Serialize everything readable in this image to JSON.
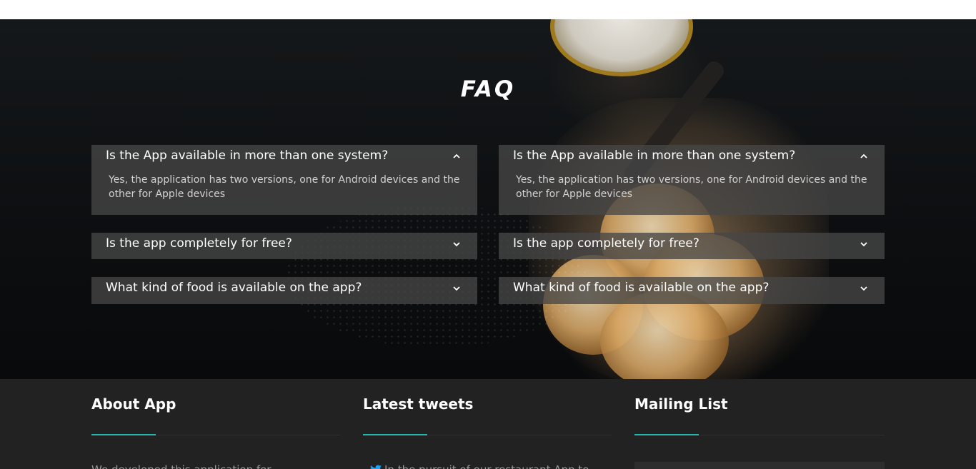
{
  "faq": {
    "title": "FAQ",
    "columns": [
      {
        "items": [
          {
            "question": "Is the App available in more than one system?",
            "answer": "Yes, the application has two versions, one for Android devices and the other for Apple devices",
            "expanded": true
          },
          {
            "question": "Is the app completely for free?",
            "expanded": false
          },
          {
            "question": "What kind of food is available on the app?",
            "expanded": false
          }
        ]
      },
      {
        "items": [
          {
            "question": "Is the App available in more than one system?",
            "answer": "Yes, the application has two versions, one for Android devices and the other for Apple devices",
            "expanded": true
          },
          {
            "question": "Is the app completely for free?",
            "expanded": false
          },
          {
            "question": "What kind of food is available on the app?",
            "expanded": false
          }
        ]
      }
    ]
  },
  "footer": {
    "about": {
      "title": "About App",
      "text": "We developed this application for"
    },
    "tweets": {
      "title": "Latest tweets",
      "text": "In the pursuit of our restaurant App to",
      "icon": "twitter-icon"
    },
    "mailing": {
      "title": "Mailing List"
    },
    "accent_color": "#26b5aa"
  }
}
